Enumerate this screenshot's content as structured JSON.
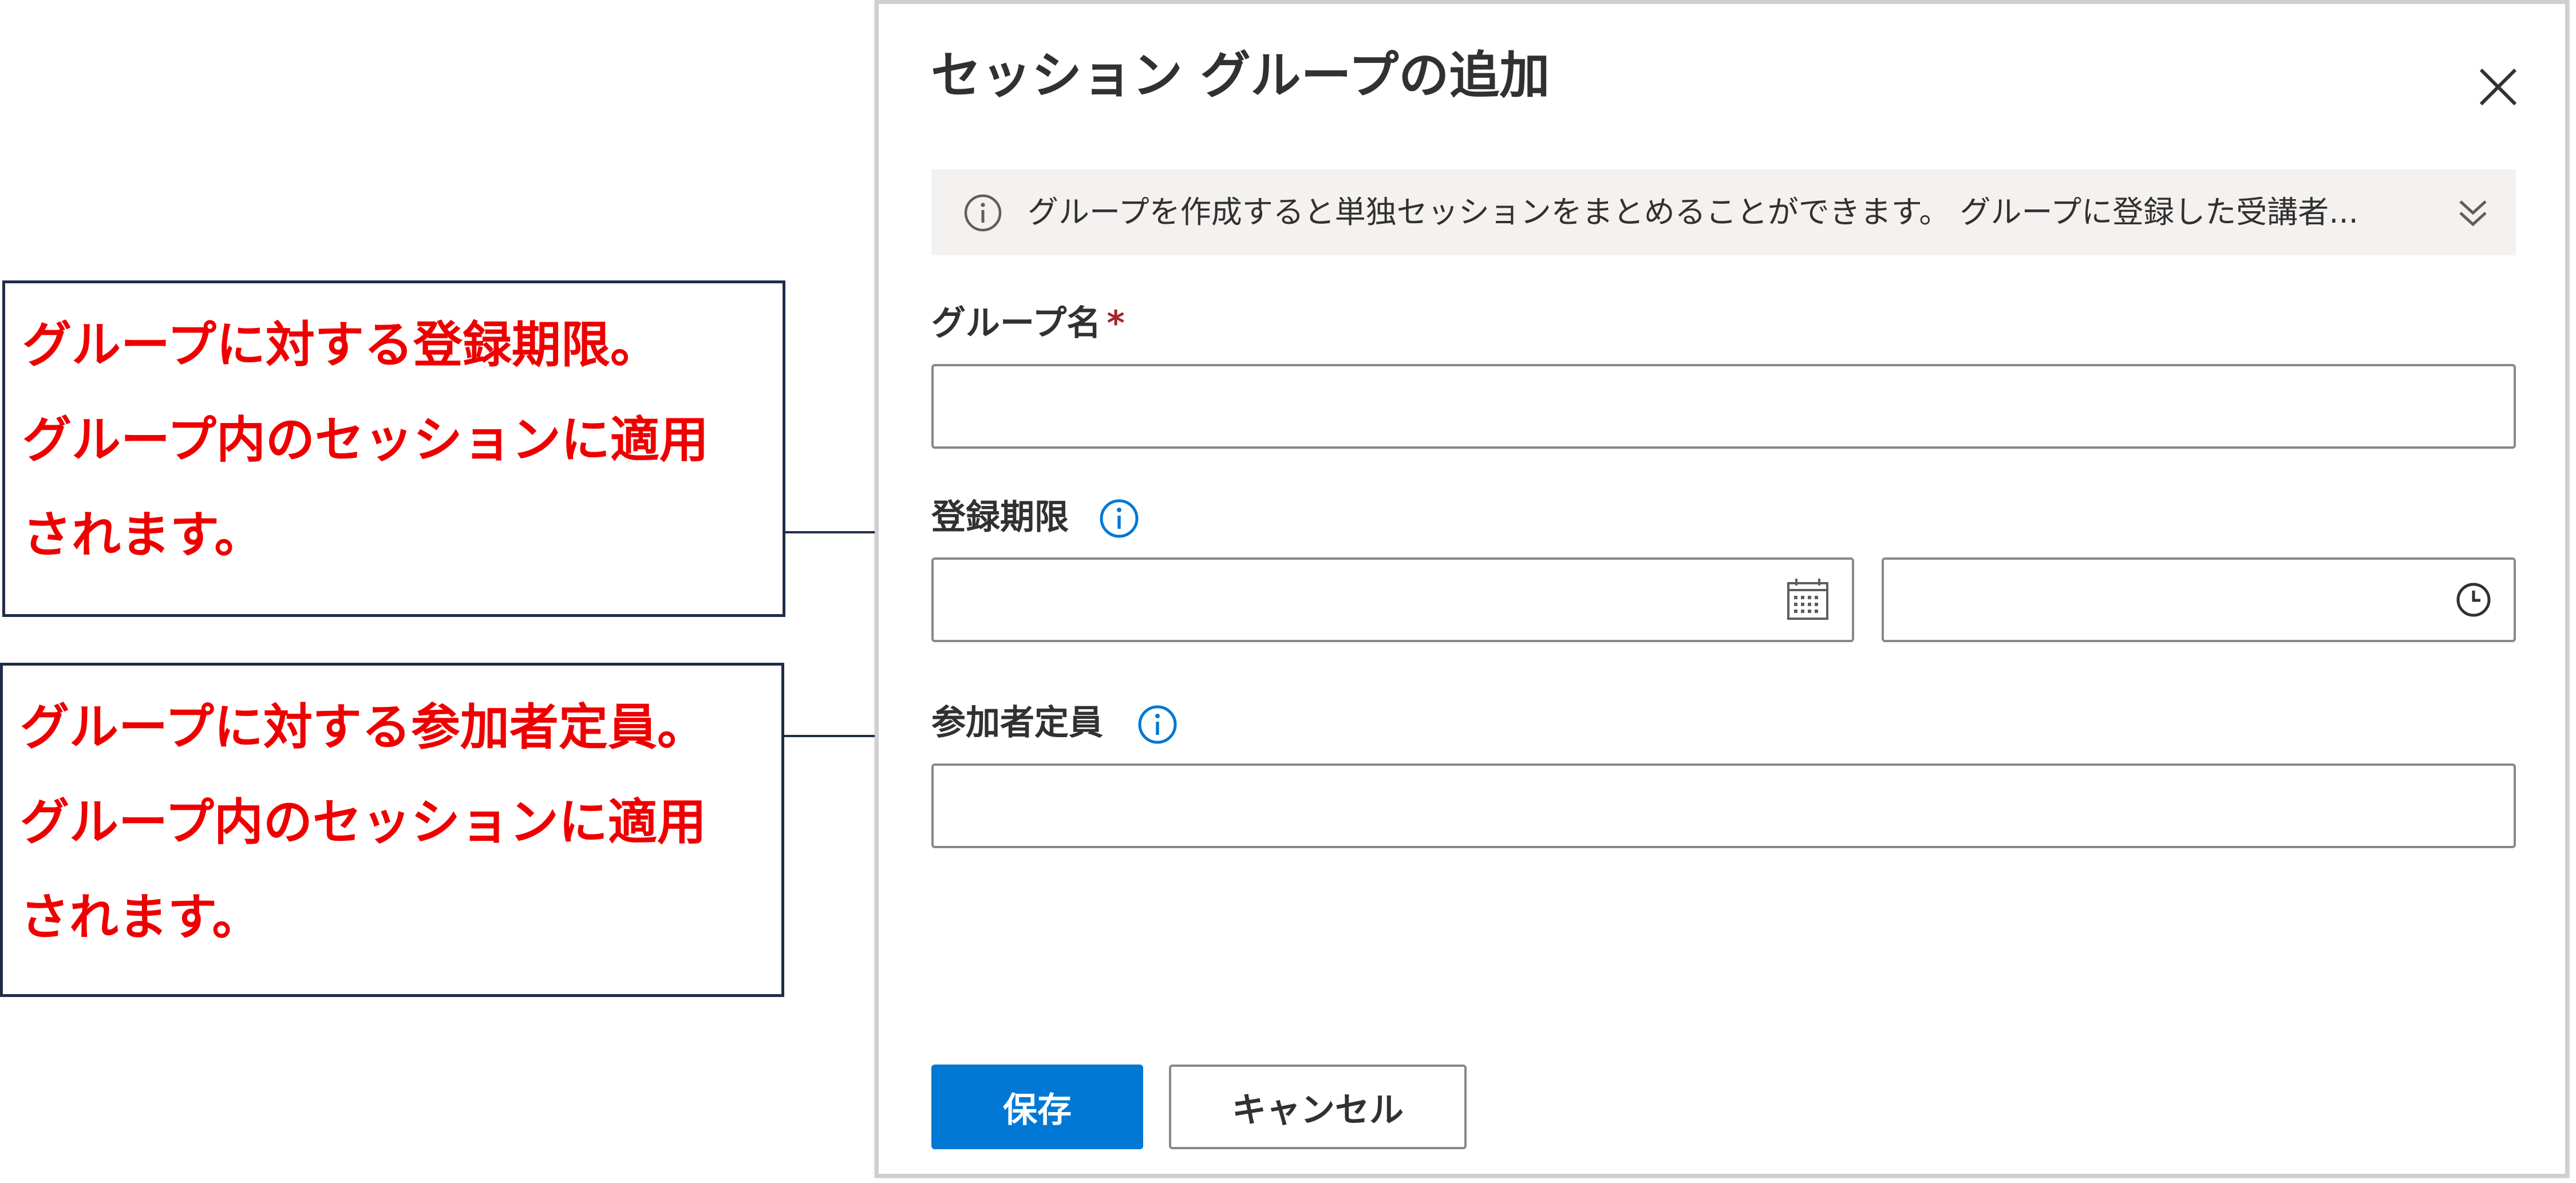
{
  "dialog": {
    "title": "セッション グループの追加",
    "info_text": "グループを作成すると単独セッションをまとめることができます。 グループに登録した受講者...",
    "fields": {
      "group_name": {
        "label": "グループ名",
        "required_mark": "*",
        "value": ""
      },
      "registration_deadline": {
        "label": "登録期限",
        "date_value": "",
        "time_value": ""
      },
      "capacity": {
        "label": "参加者定員",
        "value": ""
      }
    },
    "buttons": {
      "save": "保存",
      "cancel": "キャンセル"
    }
  },
  "callouts": {
    "deadline": {
      "line1": "グループに対する登録期限。",
      "line2": "グループ内のセッションに適用",
      "line3": "されます。"
    },
    "capacity": {
      "line1": "グループに対する参加者定員。",
      "line2": "グループ内のセッションに適用",
      "line3": "されます。"
    }
  },
  "colors": {
    "accent": "#0078d4",
    "callout_text": "#ee0000",
    "callout_border": "#1f2d4a",
    "info_bar": "#f3f2f1"
  },
  "icons": [
    "close-icon",
    "info-icon",
    "chevron-double-down-icon",
    "calendar-icon",
    "clock-icon"
  ]
}
